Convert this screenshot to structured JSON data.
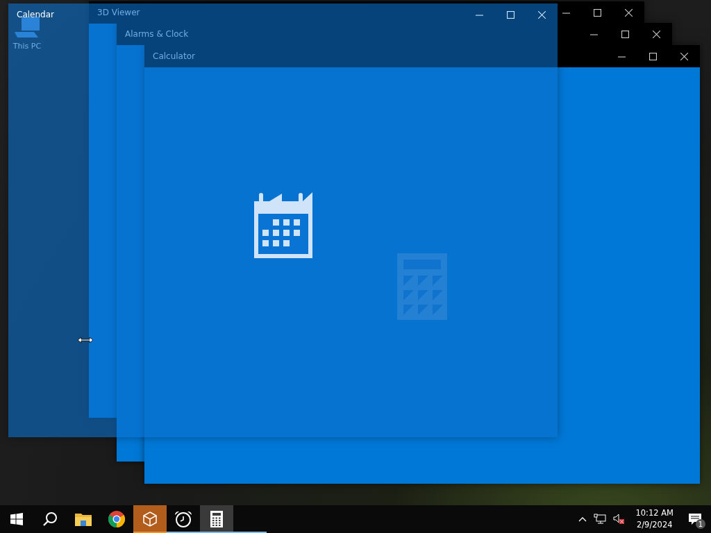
{
  "desktop": {
    "icons": [
      {
        "label": "This PC"
      }
    ]
  },
  "windows": [
    {
      "title": "3D Viewer",
      "kind": "blank",
      "focused": false
    },
    {
      "title": "Alarms & Clock",
      "kind": "blank",
      "focused": false
    },
    {
      "title": "Calculator",
      "kind": "calculator",
      "focused": false
    },
    {
      "title": "Calendar",
      "kind": "calendar",
      "focused": true
    }
  ],
  "taskbar": {
    "apps": [
      {
        "kind": "start",
        "running": false,
        "selected": false,
        "hovered": false
      },
      {
        "kind": "search",
        "running": false,
        "selected": false,
        "hovered": false
      },
      {
        "kind": "explorer",
        "running": false,
        "selected": false,
        "hovered": false
      },
      {
        "kind": "chrome",
        "running": false,
        "selected": false,
        "hovered": false
      },
      {
        "kind": "cube",
        "running": true,
        "selected": true,
        "hovered": false
      },
      {
        "kind": "alarm",
        "running": true,
        "selected": false,
        "hovered": false
      },
      {
        "kind": "calculator",
        "running": true,
        "selected": false,
        "hovered": true
      },
      {
        "kind": "blank",
        "running": true,
        "selected": false,
        "hovered": false
      }
    ],
    "time": "10:12 AM",
    "date": "2/9/2024",
    "notifications": "1"
  }
}
